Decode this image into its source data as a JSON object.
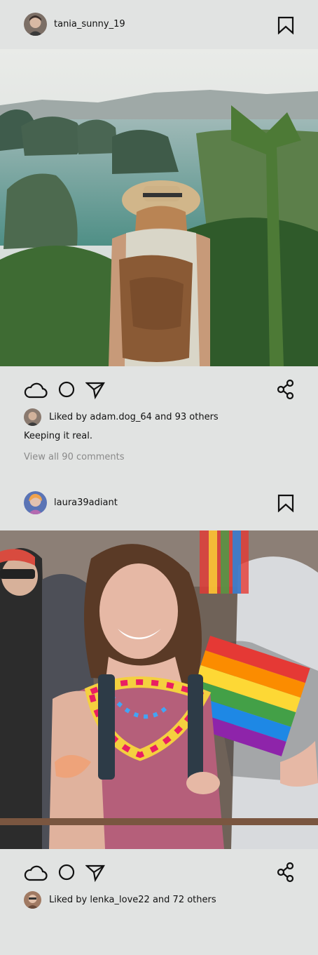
{
  "posts": [
    {
      "username": "tania_sunny_19",
      "liked_prefix": "Liked by",
      "liked_user": "adam.dog_64",
      "liked_suffix": "and 93 others",
      "caption": "Keeping it real.",
      "comments_link": "View all 90 comments",
      "icons": [
        "cloud-icon",
        "comment-circle-icon",
        "send-icon",
        "share-icon",
        "bookmark-icon"
      ]
    },
    {
      "username": "laura39adiant",
      "liked_prefix": "Liked by",
      "liked_user": "lenka_love22",
      "liked_suffix": "and 72 others",
      "icons": [
        "cloud-icon",
        "comment-circle-icon",
        "send-icon",
        "share-icon",
        "bookmark-icon"
      ]
    }
  ],
  "colors": {
    "background": "#e1e3e2",
    "text": "#111111",
    "muted": "#8a8a8a"
  }
}
